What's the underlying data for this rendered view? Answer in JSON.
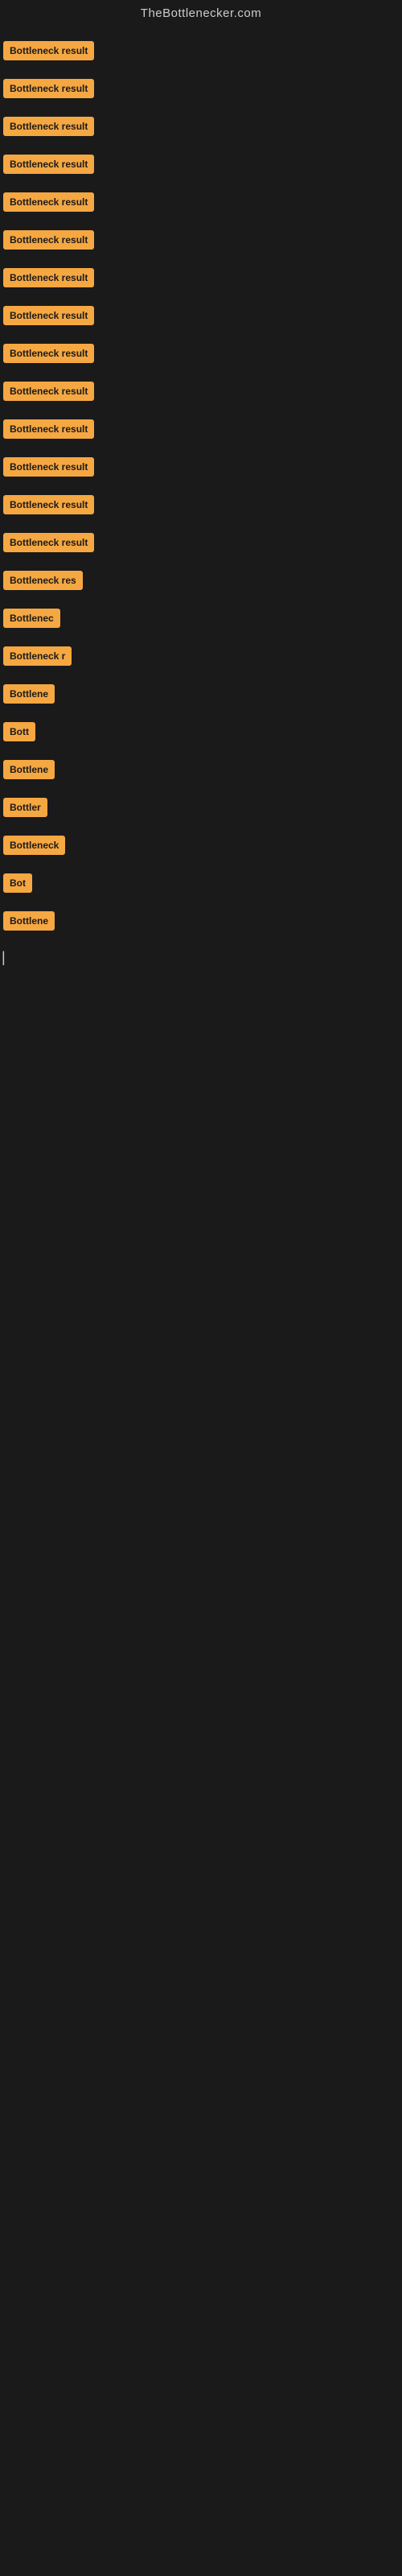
{
  "header": {
    "title": "TheBottlenecker.com"
  },
  "colors": {
    "badge_bg": "#f5a742",
    "badge_text": "#1a1a1a",
    "body_bg": "#1a1a1a",
    "header_text": "#cccccc"
  },
  "items": [
    {
      "label": "Bottleneck result",
      "width": "full"
    },
    {
      "label": "Bottleneck result",
      "width": "full"
    },
    {
      "label": "Bottleneck result",
      "width": "full"
    },
    {
      "label": "Bottleneck result",
      "width": "full"
    },
    {
      "label": "Bottleneck result",
      "width": "full"
    },
    {
      "label": "Bottleneck result",
      "width": "full"
    },
    {
      "label": "Bottleneck result",
      "width": "full"
    },
    {
      "label": "Bottleneck result",
      "width": "full"
    },
    {
      "label": "Bottleneck result",
      "width": "full"
    },
    {
      "label": "Bottleneck result",
      "width": "full"
    },
    {
      "label": "Bottleneck result",
      "width": "full"
    },
    {
      "label": "Bottleneck result",
      "width": "full"
    },
    {
      "label": "Bottleneck result",
      "width": "full"
    },
    {
      "label": "Bottleneck result",
      "width": "full"
    },
    {
      "label": "Bottleneck res",
      "width": "partial1"
    },
    {
      "label": "Bottlenec",
      "width": "partial2"
    },
    {
      "label": "Bottleneck r",
      "width": "partial3"
    },
    {
      "label": "Bottlene",
      "width": "partial4"
    },
    {
      "label": "Bott",
      "width": "partial5"
    },
    {
      "label": "Bottlene",
      "width": "partial4"
    },
    {
      "label": "Bottler",
      "width": "partial6"
    },
    {
      "label": "Bottleneck",
      "width": "partial7"
    },
    {
      "label": "Bot",
      "width": "partial8"
    },
    {
      "label": "Bottlene",
      "width": "partial4"
    }
  ],
  "cursor": {
    "symbol": "|"
  }
}
